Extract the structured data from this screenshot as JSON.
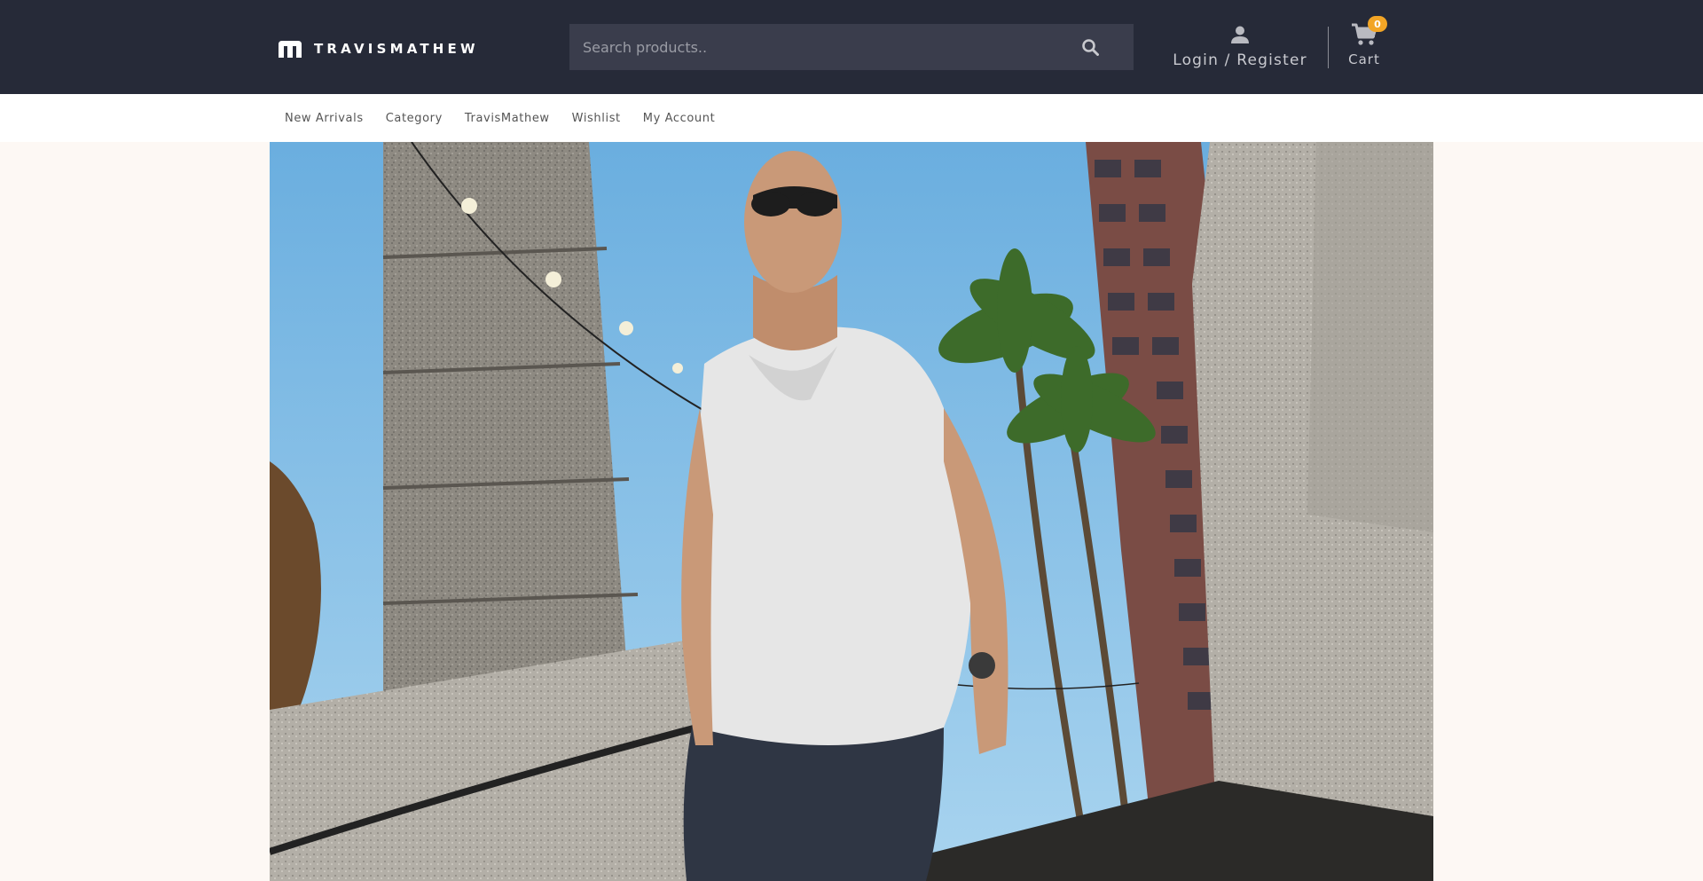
{
  "brand": {
    "name": "TRAVISMATHEW",
    "logo_icon": "tm-monogram-icon"
  },
  "search": {
    "placeholder": "Search products..",
    "value": "",
    "icon": "search-icon"
  },
  "account": {
    "label": "Login / Register",
    "icon": "user-icon"
  },
  "cart": {
    "label": "Cart",
    "count": "0",
    "icon": "cart-icon"
  },
  "nav": {
    "items": [
      "New Arrivals",
      "Category",
      "TravisMathew",
      "Wishlist",
      "My Account"
    ]
  },
  "colors": {
    "header_bg": "#262a38",
    "search_bg": "#3a3d4c",
    "badge": "#f2a526",
    "page_bg": "#fdf8f4"
  },
  "hero": {
    "description_icon": "hero-banner-image"
  }
}
